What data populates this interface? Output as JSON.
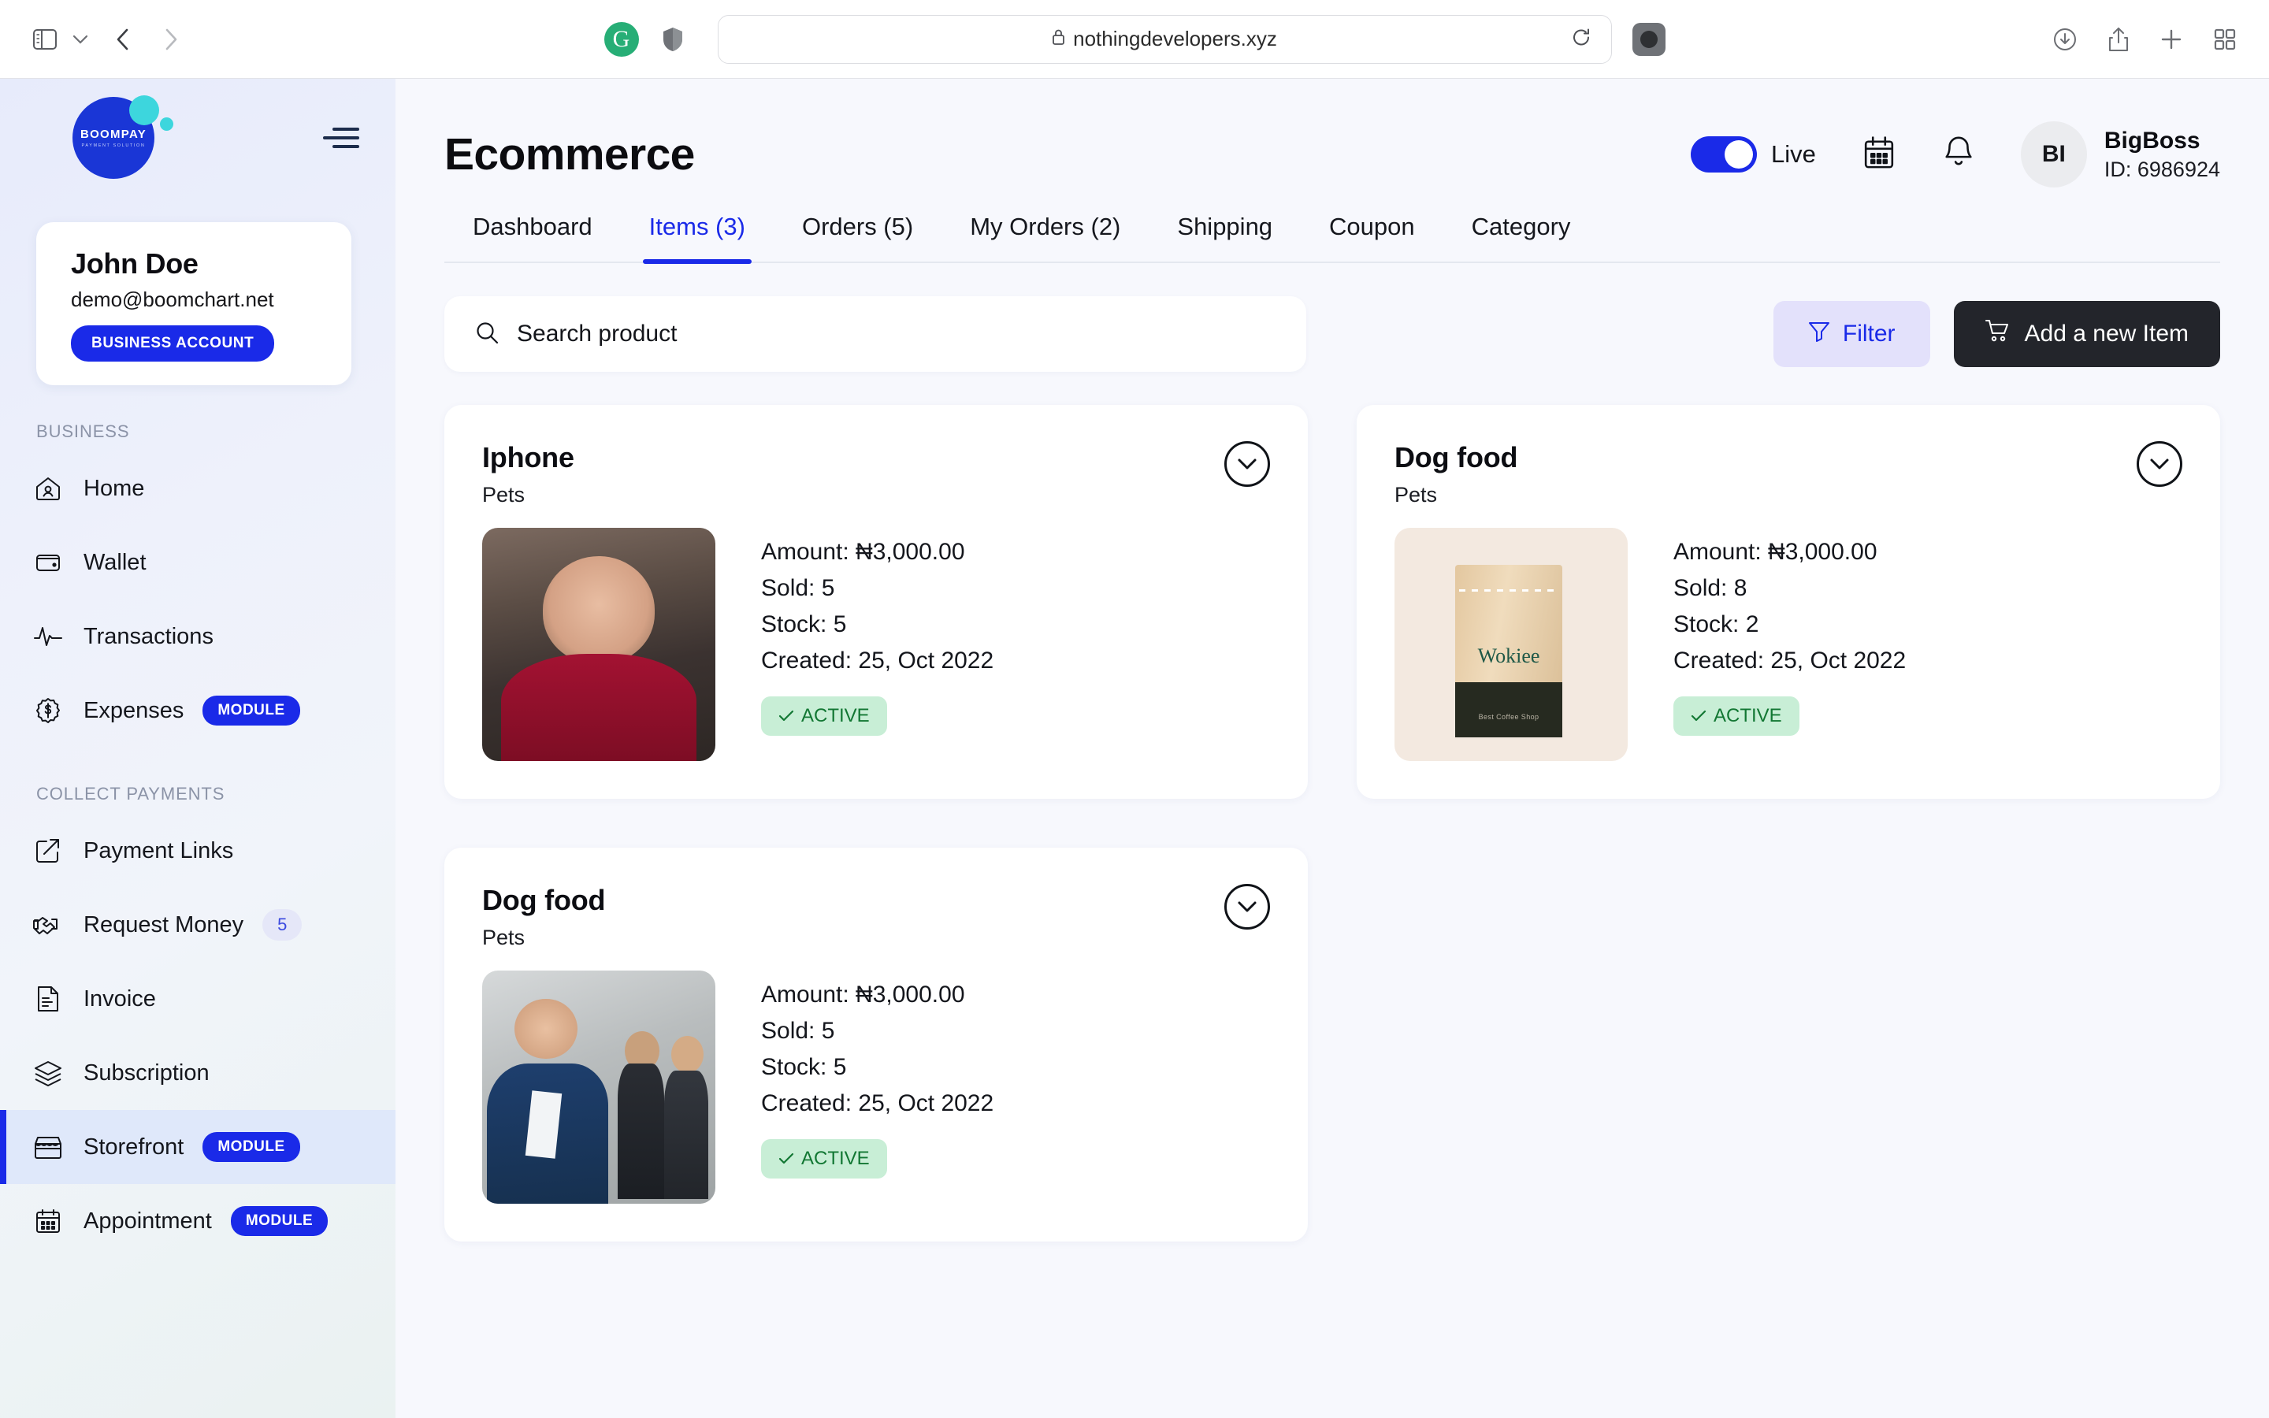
{
  "browser": {
    "url": "nothingdevelopers.xyz",
    "icons": {
      "sidebar_toggle": "sidebar-toggle-icon",
      "tab_dropdown": "chevron-down-icon",
      "back": "back-arrow-icon",
      "forward": "forward-arrow-icon",
      "grammarly": "grammarly-icon",
      "grammarly_letter": "G",
      "shield": "shield-icon",
      "lock": "lock-icon",
      "reload": "reload-icon",
      "reader": "privacy-report-icon",
      "download": "download-icon",
      "share": "share-icon",
      "new_tab": "plus-icon",
      "tab_overview": "tab-overview-icon"
    }
  },
  "sidebar": {
    "logo": {
      "name": "BOOMPAY",
      "tagline": "PAYMENT SOLUTION"
    },
    "menu_icon": "hamburger-icon",
    "profile": {
      "name": "John Doe",
      "email": "demo@boomchart.net",
      "account_type": "BUSINESS ACCOUNT"
    },
    "sections": [
      {
        "label": "BUSINESS",
        "items": [
          {
            "label": "Home",
            "icon": "home-icon",
            "badge": null,
            "count": null,
            "active": false
          },
          {
            "label": "Wallet",
            "icon": "wallet-icon",
            "badge": null,
            "count": null,
            "active": false
          },
          {
            "label": "Transactions",
            "icon": "activity-icon",
            "badge": null,
            "count": null,
            "active": false
          },
          {
            "label": "Expenses",
            "icon": "dollar-badge-icon",
            "badge": "MODULE",
            "count": null,
            "active": false
          }
        ]
      },
      {
        "label": "COLLECT PAYMENTS",
        "items": [
          {
            "label": "Payment Links",
            "icon": "external-link-icon",
            "badge": null,
            "count": null,
            "active": false
          },
          {
            "label": "Request Money",
            "icon": "handshake-icon",
            "badge": null,
            "count": "5",
            "active": false
          },
          {
            "label": "Invoice",
            "icon": "invoice-icon",
            "badge": null,
            "count": null,
            "active": false
          },
          {
            "label": "Subscription",
            "icon": "layers-icon",
            "badge": null,
            "count": null,
            "active": false
          },
          {
            "label": "Storefront",
            "icon": "storefront-icon",
            "badge": "MODULE",
            "count": null,
            "active": true
          },
          {
            "label": "Appointment",
            "icon": "calendar-icon",
            "badge": "MODULE",
            "count": null,
            "active": false
          }
        ]
      }
    ]
  },
  "header": {
    "title": "Ecommerce",
    "live_toggle": {
      "label": "Live",
      "on": true
    },
    "calendar_icon": "calendar-icon",
    "bell_icon": "bell-icon",
    "avatar_initials": "BI",
    "user_name": "BigBoss",
    "user_id": "ID: 6986924"
  },
  "tabs": [
    {
      "label": "Dashboard",
      "active": false
    },
    {
      "label": "Items (3)",
      "active": true
    },
    {
      "label": "Orders (5)",
      "active": false
    },
    {
      "label": "My Orders (2)",
      "active": false
    },
    {
      "label": "Shipping",
      "active": false
    },
    {
      "label": "Coupon",
      "active": false
    },
    {
      "label": "Category",
      "active": false
    }
  ],
  "toolbar": {
    "search_placeholder": "Search product",
    "search_value": "",
    "search_icon": "search-icon",
    "filter_label": "Filter",
    "filter_icon": "funnel-icon",
    "add_label": "Add a new Item",
    "add_icon": "shopping-cart-icon"
  },
  "products": [
    {
      "title": "Iphone",
      "category": "Pets",
      "amount": "Amount: ₦3,000.00",
      "sold": "Sold: 5",
      "stock": "Stock: 5",
      "created": "Created: 25, Oct 2022",
      "status": "ACTIVE",
      "thumb": "woman-in-red-photo",
      "expand_icon": "chevron-down-circle-icon"
    },
    {
      "title": "Dog food",
      "category": "Pets",
      "amount": "Amount: ₦3,000.00",
      "sold": "Sold: 8",
      "stock": "Stock: 2",
      "created": "Created: 25, Oct 2022",
      "status": "ACTIVE",
      "thumb": "coffee-bag-photo",
      "thumb_text": {
        "brand": "Wokiee",
        "sub": "Best Coffee Shop"
      },
      "expand_icon": "chevron-down-circle-icon"
    },
    {
      "title": "Dog food",
      "category": "Pets",
      "amount": "Amount: ₦3,000.00",
      "sold": "Sold: 5",
      "stock": "Stock: 5",
      "created": "Created: 25, Oct 2022",
      "status": "ACTIVE",
      "thumb": "businessman-photo",
      "expand_icon": "chevron-down-circle-icon"
    }
  ],
  "colors": {
    "brand_blue": "#1a2ae8",
    "accent_teal": "#3dd6dd",
    "dark_button": "#23252b",
    "status_green_bg": "#c8eed6",
    "status_green_text": "#127733",
    "page_bg": "#f7f8fd"
  }
}
